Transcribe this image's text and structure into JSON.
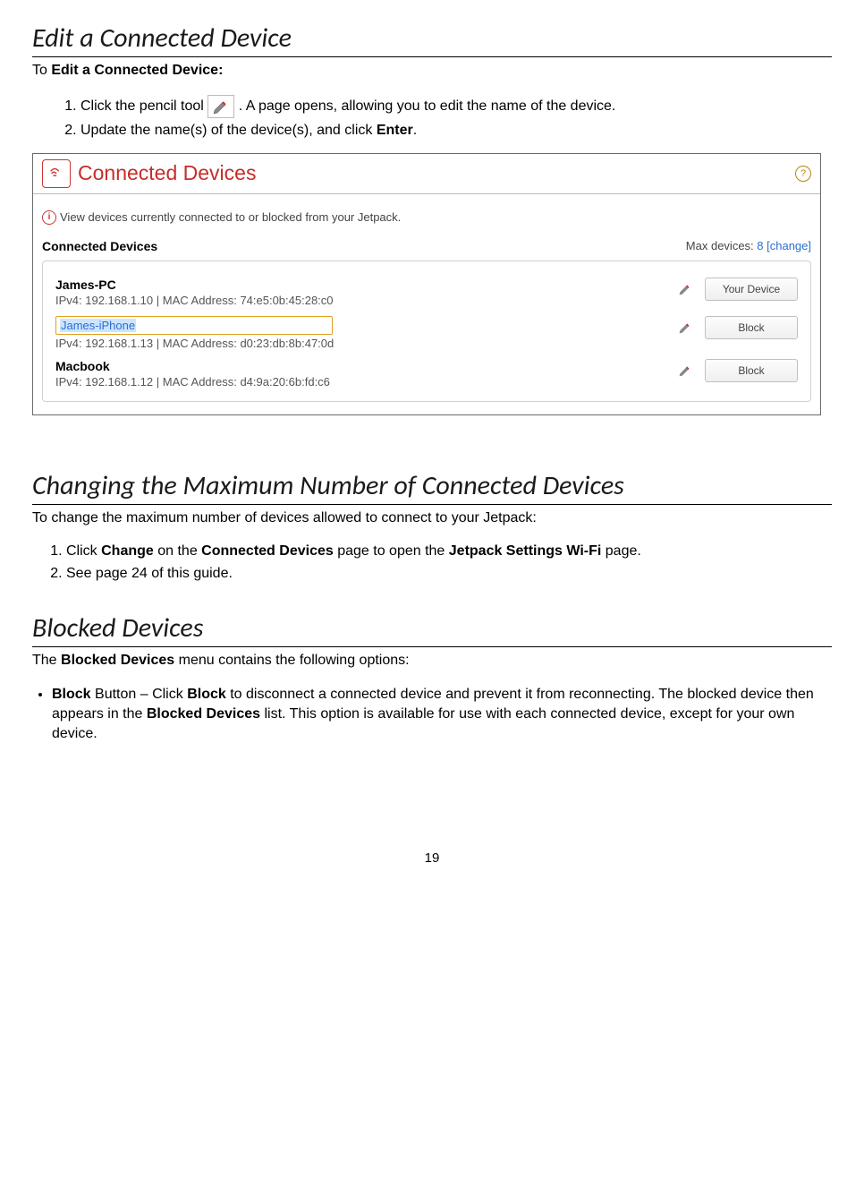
{
  "section1": {
    "title": "Edit a Connected Device",
    "intro_prefix": "To ",
    "intro_bold": "Edit a Connected Device:",
    "step1_a": "Click the pencil tool  ",
    "step1_b": ". A page opens, allowing you to edit the name of the device.",
    "step2_a": "Update the name(s) of the device(s), and click ",
    "step2_bold": "Enter",
    "step2_b": "."
  },
  "panel": {
    "title": "Connected Devices",
    "info_text": "View devices currently connected to or blocked from your Jetpack.",
    "sub_left": "Connected Devices",
    "sub_right_label": "Max devices: ",
    "sub_right_value": "8 ",
    "sub_right_change": "[change]",
    "your_device_btn": "Your Device",
    "block_btn": "Block",
    "devices": [
      {
        "name": "James-PC",
        "ip": "IPv4: 192.168.1.10 | MAC Address: 74:e5:0b:45:28:c0"
      },
      {
        "name": "James-iPhone",
        "ip": "IPv4: 192.168.1.13 | MAC Address: d0:23:db:8b:47:0d"
      },
      {
        "name": "Macbook",
        "ip": "IPv4: 192.168.1.12 | MAC Address: d4:9a:20:6b:fd:c6"
      }
    ]
  },
  "section2": {
    "title": "Changing the Maximum Number of Connected Devices",
    "intro": "To change the maximum number of devices allowed to connect to your Jetpack:",
    "step1_a": "Click ",
    "step1_b1": "Change",
    "step1_c": " on the ",
    "step1_b2": "Connected Devices",
    "step1_d": " page to open the ",
    "step1_b3": "Jetpack Settings Wi-Fi",
    "step1_e": " page.",
    "step2": " See page 24 of this guide."
  },
  "section3": {
    "title": "Blocked Devices",
    "intro_a": "The ",
    "intro_b": "Blocked Devices",
    "intro_c": " menu contains the following options:",
    "bullet_b1": "Block",
    "bullet_t1": " Button – Click ",
    "bullet_b2": "Block",
    "bullet_t2": " to disconnect a connected device and prevent it from reconnecting. The blocked device then appears in the ",
    "bullet_b3": "Blocked Devices",
    "bullet_t3": " list. This option is available for use with each connected device, except for your own device."
  },
  "page_number": "19"
}
